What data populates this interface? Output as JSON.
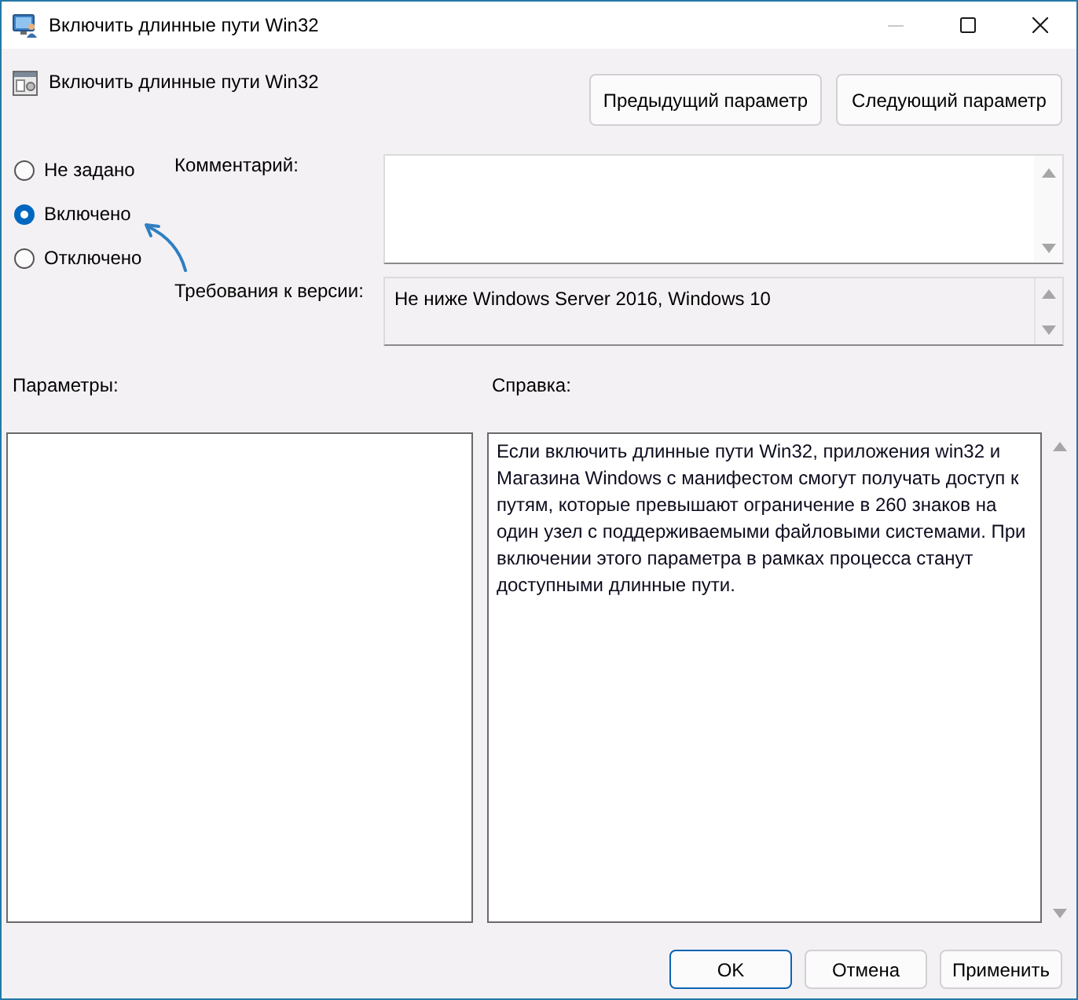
{
  "window": {
    "title": "Включить длинные пути Win32",
    "controls": [
      {
        "kind": "minimize",
        "disabled": true
      },
      {
        "kind": "maximize",
        "disabled": false
      },
      {
        "kind": "close",
        "disabled": false
      }
    ]
  },
  "header": {
    "title": "Включить длинные пути Win32",
    "buttons": [
      "Предыдущий параметр",
      "Следующий параметр"
    ]
  },
  "state_options": [
    {
      "label": "Не задано",
      "selected": false
    },
    {
      "label": "Включено",
      "selected": true
    },
    {
      "label": "Отключено",
      "selected": false
    }
  ],
  "comment": {
    "label": "Комментарий:"
  },
  "version_requirements": {
    "label": "Требования к версии:",
    "value": "Не ниже Windows Server 2016, Windows 10"
  },
  "options_panel": {
    "label": "Параметры:"
  },
  "help_panel": {
    "label": "Справка:",
    "text": "Если включить длинные пути Win32, приложения win32 и Магазина Windows с манифестом смогут получать доступ к путям, которые превышают ограничение в 260 знаков на один узел с поддерживаемыми файловыми системами. При включении этого параметра в рамках процесса станут доступными длинные пути."
  },
  "buttons": [
    {
      "label": "OK",
      "default": true
    },
    {
      "label": "Отмена",
      "default": false
    },
    {
      "label": "Применить",
      "default": false
    }
  ]
}
